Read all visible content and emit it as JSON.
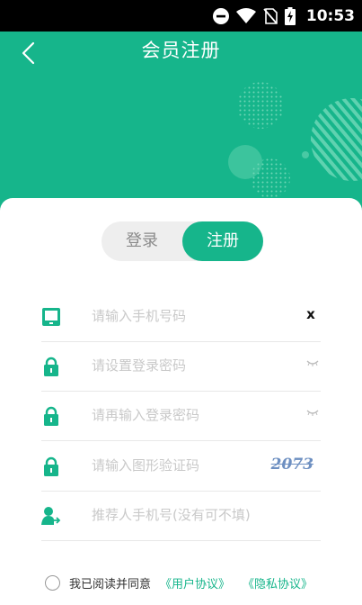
{
  "status_bar": {
    "time": "10:53",
    "icons": [
      "do-not-disturb-icon",
      "wifi-icon",
      "no-sim-icon",
      "battery-charging-icon"
    ]
  },
  "header": {
    "title": "会员注册",
    "back_icon": "chevron-left-icon",
    "background_color": "#16b58b"
  },
  "toggle": {
    "login_label": "登录",
    "register_label": "注册",
    "active": "register"
  },
  "form": {
    "fields": [
      {
        "icon": "phone-icon",
        "placeholder": "请输入手机号码",
        "value": "",
        "action_icon": "clear-icon",
        "action_text": "x"
      },
      {
        "icon": "lock-icon",
        "placeholder": "请设置登录密码",
        "value": "",
        "action_icon": "eye-closed-icon"
      },
      {
        "icon": "lock-icon",
        "placeholder": "请再输入登录密码",
        "value": "",
        "action_icon": "eye-closed-icon"
      },
      {
        "icon": "lock-icon",
        "placeholder": "请输入图形验证码",
        "value": "",
        "captcha": "2073"
      },
      {
        "icon": "user-referral-icon",
        "placeholder": "推荐人手机号(没有可不填)",
        "value": ""
      }
    ]
  },
  "agreement": {
    "text": "我已阅读并同意",
    "user_agreement": "《用户协议》",
    "privacy_agreement": "《隐私协议》",
    "checked": false
  },
  "colors": {
    "accent": "#16b58b",
    "toggle_bg": "#eeeeee",
    "divider": "#e8e8e8",
    "placeholder": "#c9c9c9"
  }
}
